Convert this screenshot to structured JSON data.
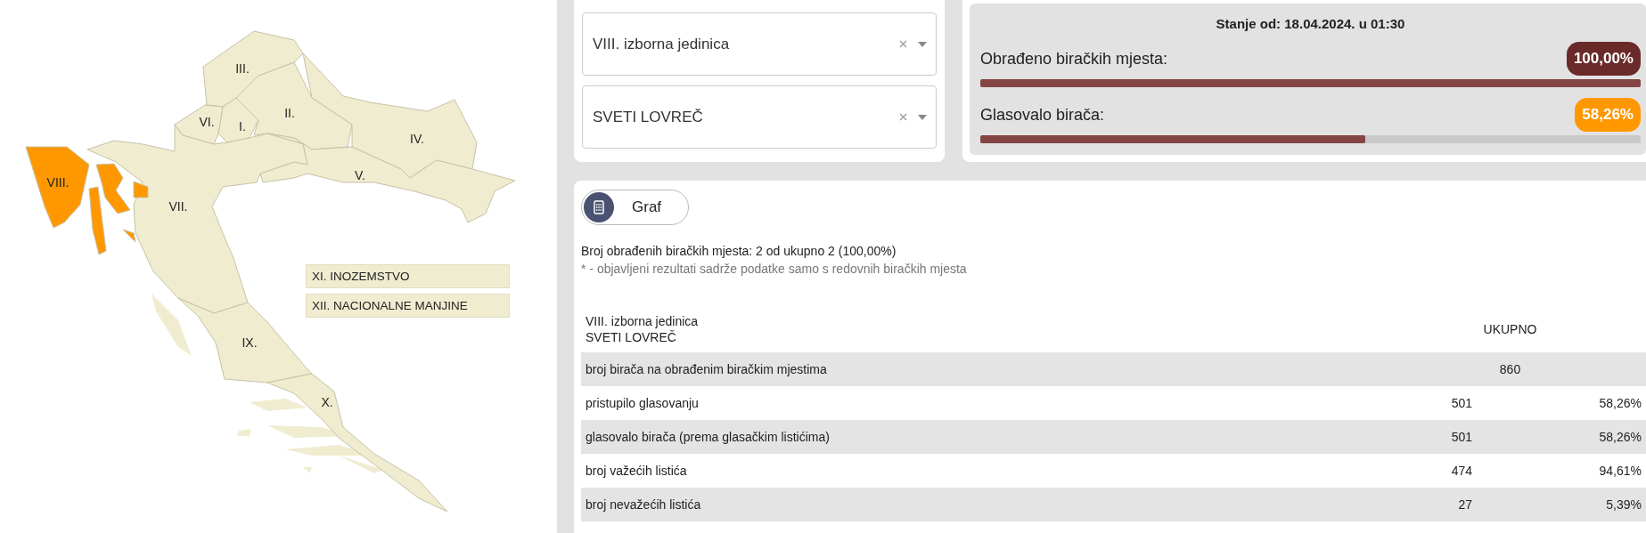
{
  "map": {
    "regions": [
      {
        "label": "I.",
        "selected": false
      },
      {
        "label": "II.",
        "selected": false
      },
      {
        "label": "III.",
        "selected": false
      },
      {
        "label": "IV.",
        "selected": false
      },
      {
        "label": "V.",
        "selected": false
      },
      {
        "label": "VI.",
        "selected": false
      },
      {
        "label": "VII.",
        "selected": false
      },
      {
        "label": "VIII.",
        "selected": true
      },
      {
        "label": "IX.",
        "selected": false
      },
      {
        "label": "X.",
        "selected": false
      }
    ],
    "extra_units": [
      {
        "label": "XI. INOZEMSTVO",
        "selected": false
      },
      {
        "label": "XII. NACIONALNE MANJINE",
        "selected": false
      }
    ]
  },
  "filters": [
    {
      "value": "VIII. izborna jedinica"
    },
    {
      "value": "SVETI LOVREČ"
    }
  ],
  "status": {
    "title": "Stanje od: 18.04.2024. u 01:30",
    "meters": [
      {
        "label": "Obrađeno biračkih mjesta:",
        "badge": "100,00%",
        "color": "#6b2a2a",
        "level": 1.0
      },
      {
        "label": "Glasovalo birača:",
        "badge": "58,26%",
        "color": "#ff9800",
        "level": 0.5826
      }
    ]
  },
  "results": {
    "view_button": "Graf",
    "summary": "Broj obrađenih biračkih mjesta: 2 od ukupno 2 (100,00%)",
    "note": "* - objavljeni rezultati sadrže podatke samo s redovnih biračkih mjesta",
    "table": {
      "header": {
        "unit": "VIII. izborna jedinica",
        "place": "SVETI LOVREČ",
        "total": "UKUPNO"
      },
      "rows": [
        {
          "kind": "span",
          "label": "broj birača na obrađenim biračkim mjestima",
          "count": "860"
        },
        {
          "kind": "split",
          "label": "pristupilo glasovanju",
          "count": "501",
          "percent": "58,26%"
        },
        {
          "kind": "split",
          "label": "glasovalo birača (prema glasačkim listićima)",
          "count": "501",
          "percent": "58,26%"
        },
        {
          "kind": "split",
          "label": "broj važećih listića",
          "count": "474",
          "percent": "94,61%"
        },
        {
          "kind": "split",
          "label": "broj nevažećih listića",
          "count": "27",
          "percent": "5,39%"
        }
      ]
    }
  }
}
